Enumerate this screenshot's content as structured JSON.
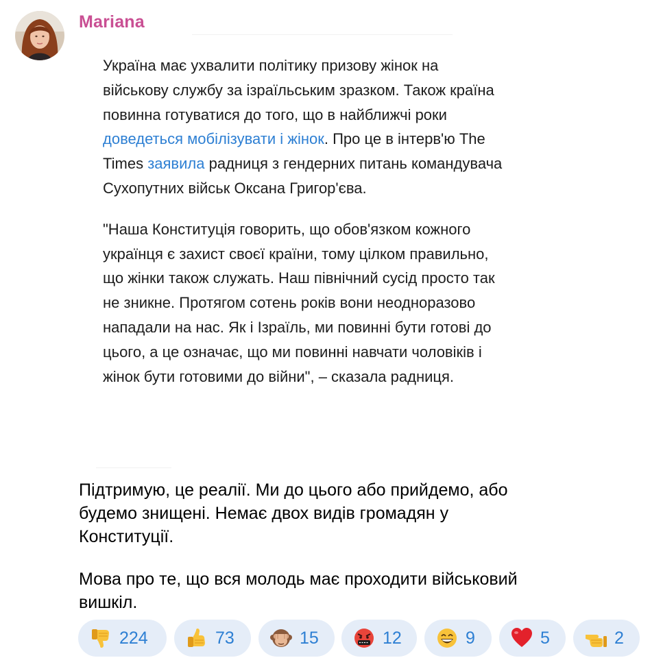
{
  "author": {
    "name": "Mariana"
  },
  "quote": {
    "paragraph1": {
      "before_link1": "Україна має ухвалити політику призову жінок на військову службу за ізраїльським зразком. Також країна повинна готуватися до того, що в найближчі роки ",
      "link1": "доведеться мобілізувати і жінок",
      "between_links": ". Про це в інтерв'ю The Times ",
      "link2": "заявила",
      "after_link2": " радниця з гендерних питань командувача Сухопутних військ Оксана Григор'єва."
    },
    "paragraph2": "\"Наша Конституція говорить, що обов'язком кожного українця є захист своєї країни, тому цілком правильно, що жінки також служать. Наш північний сусід просто так не зникне. Протягом сотень років вони неодноразово нападали на нас. Як і Ізраїль, ми повинні бути готові до цього, а це означає, що ми повинні навчати чоловіків і жінок бути готовими до війни\", – сказала радниця."
  },
  "comment": {
    "paragraph1": "Підтримую, це реалії. Ми до цього або прийдемо, або будемо знищені. Немає двох видів громадян у Конституції.",
    "paragraph2": "Мова про те, що вся молодь має проходити військовий вишкіл."
  },
  "reactions": [
    {
      "icon": "thumbs-down-icon",
      "count": "224"
    },
    {
      "icon": "thumbs-up-icon",
      "count": "73"
    },
    {
      "icon": "see-no-evil-monkey-icon",
      "count": "15"
    },
    {
      "icon": "cursing-face-icon",
      "count": "12"
    },
    {
      "icon": "grinning-face-icon",
      "count": "9"
    },
    {
      "icon": "red-heart-icon",
      "count": "5"
    },
    {
      "icon": "pointing-hand-icon",
      "count": "2"
    }
  ],
  "colors": {
    "author_name": "#c94f93",
    "link": "#2d7fd3",
    "reaction_background": "#e5edf8",
    "reaction_count": "#2d7fd3"
  }
}
